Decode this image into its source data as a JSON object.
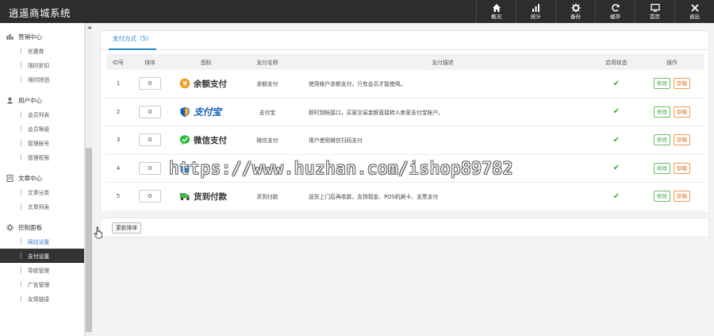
{
  "app": {
    "title": "逍遥商城系统"
  },
  "topnav": [
    {
      "label": "概况",
      "icon": "home-icon"
    },
    {
      "label": "统计",
      "icon": "bar-chart-icon"
    },
    {
      "label": "备份",
      "icon": "gear-icon"
    },
    {
      "label": "缓存",
      "icon": "refresh-icon"
    },
    {
      "label": "首页",
      "icon": "monitor-icon"
    },
    {
      "label": "退出",
      "icon": "close-icon"
    }
  ],
  "sidebar": {
    "groups": [
      {
        "title": "营销中心",
        "icon": "marketing-icon",
        "items": [
          "优惠券",
          "限时折扣",
          "限时拼团"
        ]
      },
      {
        "title": "用户中心",
        "icon": "user-icon",
        "items": [
          "会员列表",
          "会员等级",
          "管理帐号",
          "管理权限"
        ]
      },
      {
        "title": "文章中心",
        "icon": "article-icon",
        "items": [
          "文章分类",
          "文章列表"
        ]
      },
      {
        "title": "控制面板",
        "icon": "settings-icon",
        "items": [
          "网站设置",
          "支付设置",
          "导航管理",
          "广告管理",
          "友情链接"
        ]
      }
    ]
  },
  "main": {
    "tab_label": "支付方式（5）",
    "columns": [
      "ID号",
      "排序",
      "图标",
      "支付名称",
      "支付描述",
      "启用状态",
      "操作"
    ],
    "rows": [
      {
        "id": "1",
        "sort": "0",
        "logo_text": "余额支付",
        "logo_icon": "balance-icon",
        "name": "余额支付",
        "desc": "使用帐户余额支付，只有会员才能使用。",
        "status": "✔"
      },
      {
        "id": "2",
        "sort": "0",
        "logo_text": "支付宝",
        "logo_icon": "alipay-icon",
        "name": "支付宝",
        "desc": "即时到帐接口，买家交易金额直接转入卖家支付宝账户。",
        "status": "✔"
      },
      {
        "id": "3",
        "sort": "0",
        "logo_text": "微信支付",
        "logo_icon": "wechat-icon",
        "name": "微信支付",
        "desc": "用户使用微信扫码支付",
        "status": "✔"
      },
      {
        "id": "4",
        "sort": "0",
        "logo_text": "",
        "logo_icon": "bank-icon",
        "name": "",
        "desc": "",
        "status": "✔"
      },
      {
        "id": "5",
        "sort": "0",
        "logo_text": "货到付款",
        "logo_icon": "truck-icon",
        "name": "货到付款",
        "desc": "送货上门后再收款，支持现金、POS机刷卡、支票支付",
        "status": "✔"
      }
    ],
    "edit_label": "修改",
    "delete_label": "卸载",
    "update_sort_label": "更新排序"
  },
  "watermark": "https://www.huzhan.com/ishop89782",
  "colors": {
    "topbar": "#2d2d2d",
    "accent": "#1e88c7",
    "edit": "#3da843",
    "delete": "#e2721c"
  }
}
